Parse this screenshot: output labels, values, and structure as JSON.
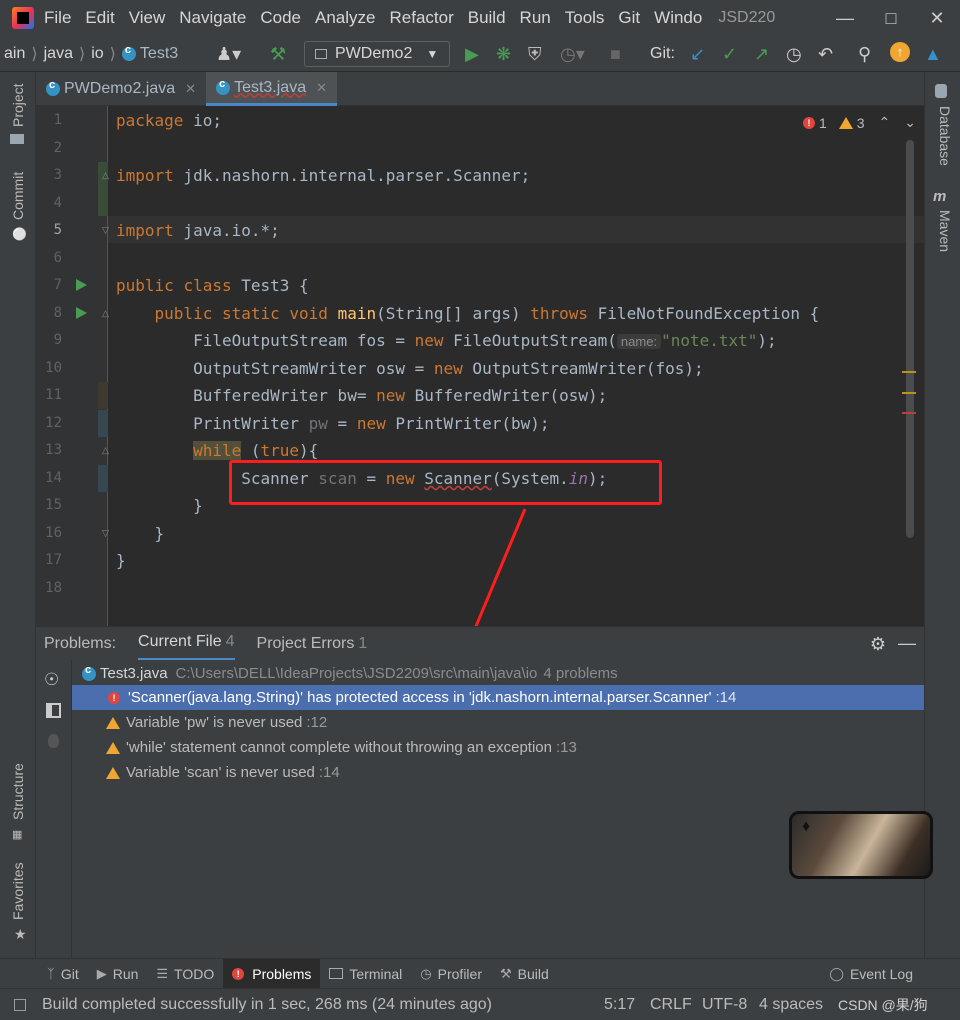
{
  "menu": {
    "items": [
      "File",
      "Edit",
      "View",
      "Navigate",
      "Code",
      "Analyze",
      "Refactor",
      "Build",
      "Run",
      "Tools",
      "Git",
      "Windo"
    ],
    "title": "JSD220"
  },
  "navbar": {
    "crumbs": [
      "ain",
      "java",
      "io",
      "Test3"
    ],
    "run_config": "PWDemo2",
    "git_label": "Git:"
  },
  "tabs": [
    {
      "label": "PWDemo2.java",
      "active": false
    },
    {
      "label": "Test3.java",
      "active": true
    }
  ],
  "left_strip": {
    "project": "Project",
    "commit": "Commit",
    "structure": "Structure",
    "favorites": "Favorites"
  },
  "right_strip": {
    "database": "Database",
    "maven": "Maven"
  },
  "inspections": {
    "errors": "1",
    "warnings": "3"
  },
  "editor": {
    "line_numbers": [
      "1",
      "2",
      "3",
      "4",
      "5",
      "6",
      "7",
      "8",
      "9",
      "10",
      "11",
      "12",
      "13",
      "14",
      "15",
      "16",
      "17",
      "18"
    ],
    "tokens": {
      "package": "package",
      "import": "import",
      "public": "public",
      "class": "class",
      "static": "static",
      "void": "void",
      "throws": "throws",
      "new": "new",
      "while": "while",
      "true": "true",
      "l1": " io;",
      "l3": " jdk.nashorn.internal.parser.Scanner;",
      "l5": " java.io.*;",
      "l7": " Test3 {",
      "main": "main",
      "l8b": "(String[] args) ",
      "l8c": " FileNotFoundException {",
      "l9a": "FileOutputStream fos = ",
      "l9b": " FileOutputStream(",
      "l9hint": "name:",
      "l9str": "\"note.txt\"",
      "l9end": ");",
      "l10a": "OutputStreamWriter osw = ",
      "l10b": " OutputStreamWriter(fos);",
      "l11a": "BufferedWriter bw= ",
      "l11b": " BufferedWriter(osw);",
      "l12a": "PrintWriter ",
      "l12var": "pw",
      "l12b": " = ",
      "l12c": " PrintWriter(bw);",
      "l13b": " (",
      "l13c": "){",
      "l14a": "Scanner ",
      "l14var": "scan",
      "l14b": " = ",
      "l14cls": "Scanner",
      "l14c": "(System.",
      "l14in": "in",
      "l14d": ");",
      "brace": "}"
    }
  },
  "problems": {
    "label": "Problems:",
    "tabs": [
      {
        "label": "Current File",
        "count": "4"
      },
      {
        "label": "Project Errors",
        "count": "1"
      }
    ],
    "file": {
      "name": "Test3.java",
      "path": "C:\\Users\\DELL\\IdeaProjects\\JSD2209\\src\\main\\java\\io",
      "summary": "4 problems"
    },
    "rows": [
      {
        "severity": "error",
        "text": "'Scanner(java.lang.String)' has protected access in 'jdk.nashorn.internal.parser.Scanner'",
        "loc": ":14"
      },
      {
        "severity": "warning",
        "text": "Variable 'pw' is never used",
        "loc": ":12"
      },
      {
        "severity": "warning",
        "text": "'while' statement cannot complete without throwing an exception",
        "loc": ":13"
      },
      {
        "severity": "warning",
        "text": "Variable 'scan' is never used",
        "loc": ":14"
      }
    ]
  },
  "tool_tabs": [
    {
      "label": "Git",
      "icon": "git-branch-icon"
    },
    {
      "label": "Run",
      "icon": "play-icon"
    },
    {
      "label": "TODO",
      "icon": "list-icon"
    },
    {
      "label": "Problems",
      "icon": "error-icon"
    },
    {
      "label": "Terminal",
      "icon": "terminal-icon"
    },
    {
      "label": "Profiler",
      "icon": "profiler-icon"
    },
    {
      "label": "Build",
      "icon": "hammer-icon"
    }
  ],
  "event_log": "Event Log",
  "status": {
    "message": "Build completed successfully in 1 sec, 268 ms (24 minutes ago)",
    "position": "5:17",
    "line_sep": "CRLF",
    "encoding": "UTF-8",
    "indent": "4 spaces",
    "watermark": "CSDN @果/狗"
  },
  "colors": {
    "accent": "#4a88c7",
    "error": "#e0453e",
    "warning": "#f0a732",
    "annotation": "#ff1d1d"
  }
}
